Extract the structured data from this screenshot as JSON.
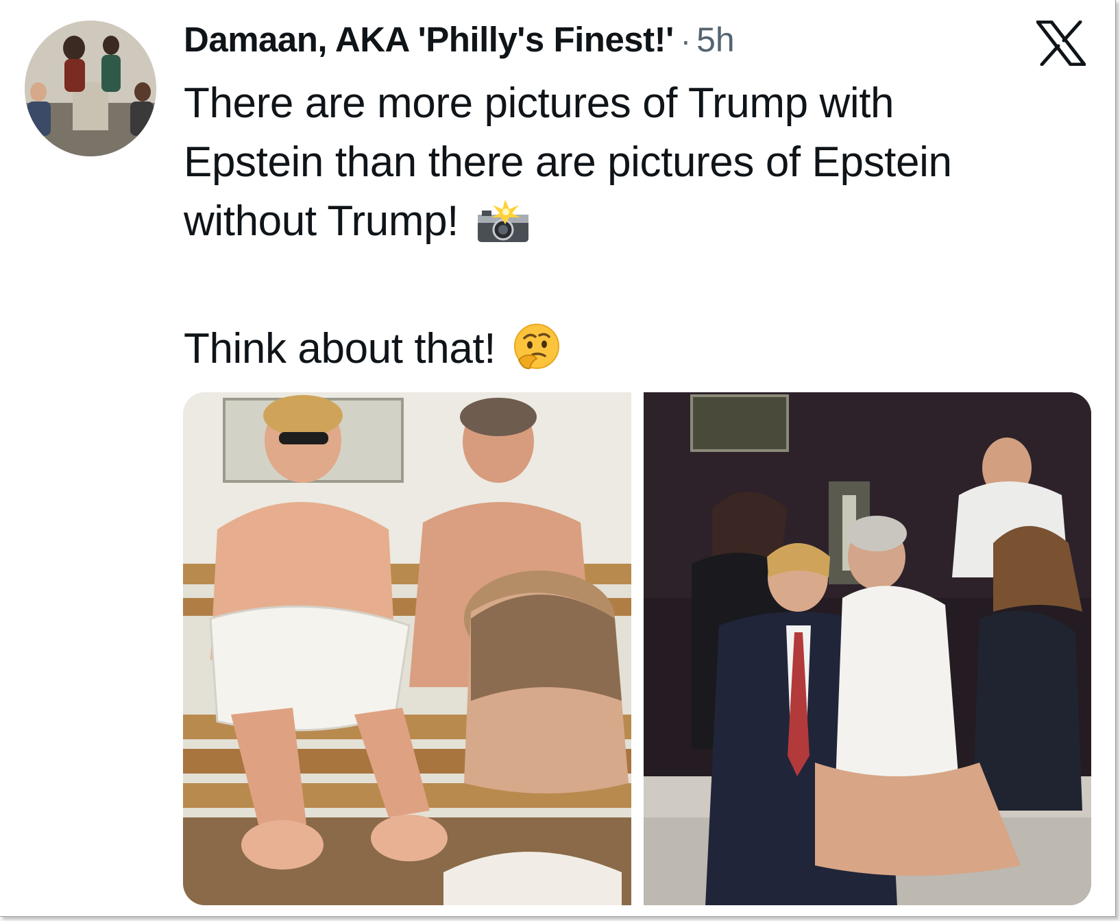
{
  "tweet": {
    "author": {
      "display_name": "Damaan, AKA 'Philly's Finest!'",
      "avatar_icon": "profile-photo"
    },
    "separator": "·",
    "timestamp": "5h",
    "brand_icon": "x-logo-icon",
    "text_lines": [
      "There are more pictures of Trump with",
      "Epstein than there are pictures of Epstein",
      "without Trump!"
    ],
    "text_emoji_1": "camera-with-flash-icon",
    "text_line_2": "Think about that!",
    "text_emoji_2": "thinking-face-icon",
    "media": [
      {
        "type": "photo",
        "icon": "photo-sauna-scene"
      },
      {
        "type": "photo",
        "icon": "photo-party-scene"
      }
    ]
  },
  "colors": {
    "text_primary": "#0f1419",
    "text_secondary": "#536471",
    "background": "#ffffff"
  }
}
